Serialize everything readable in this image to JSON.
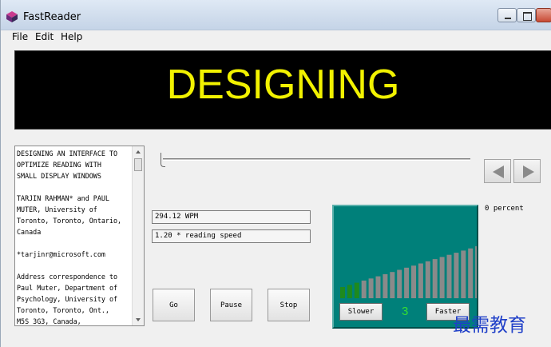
{
  "window": {
    "title": "FastReader",
    "controls": [
      "minimize",
      "maximize",
      "close"
    ]
  },
  "menu": [
    "File",
    "Edit",
    "Help"
  ],
  "display": {
    "word": "DESIGNING",
    "background": "#000000",
    "text_color": "#f2f200"
  },
  "text_panel": {
    "content": "DESIGNING AN INTERFACE TO\nOPTIMIZE READING WITH\nSMALL DISPLAY WINDOWS\n\nTARJIN RAHMAN* and PAUL\nMUTER, University of\nToronto, Toronto, Ontario,\nCanada\n\n*tarjinr@microsoft.com\n\nAddress correspondence to\nPaul Muter, Department of\nPsychology, University of\nToronto, Toronto, Ont.,\nM5S 3G3, Canada,"
  },
  "progress": {
    "position_fraction": 0.0,
    "percent_label": "0 percent"
  },
  "nav": {
    "prev_icon": "triangle-left-icon",
    "next_icon": "triangle-right-icon"
  },
  "fields": {
    "wpm": "294.12 WPM",
    "speed": "1.20 * reading speed"
  },
  "buttons": {
    "go": "Go",
    "pause": "Pause",
    "stop": "Stop"
  },
  "speed_panel": {
    "slower": "Slower",
    "faster": "Faster",
    "level": "3",
    "bar_count": 20,
    "active_bars": 3,
    "active_color": "#1e8a1e",
    "inactive_color": "#8a8a8a",
    "panel_color": "#00807a"
  },
  "watermark": "最需教育"
}
